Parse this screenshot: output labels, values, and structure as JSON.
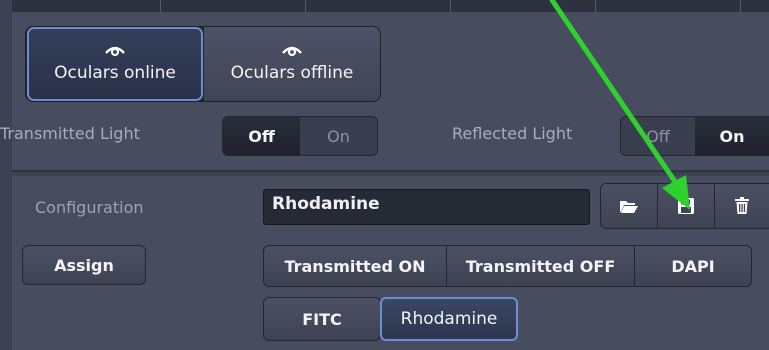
{
  "oculars": {
    "online_label": "Oculars online",
    "offline_label": "Oculars offline",
    "selected": "online"
  },
  "transmitted_light": {
    "label": "Transmitted Light",
    "off_label": "Off",
    "on_label": "On",
    "selected": "Off"
  },
  "reflected_light": {
    "label": "Reflected Light",
    "off_label": "Off",
    "on_label": "On",
    "selected": "On"
  },
  "configuration": {
    "label": "Configuration",
    "value": "Rhodamine",
    "icons": [
      "folder-open-icon",
      "save-icon",
      "trash-icon"
    ]
  },
  "assign_label": "Assign",
  "presets": [
    "Transmitted ON",
    "Transmitted OFF",
    "DAPI",
    "FITC",
    "Rhodamine"
  ],
  "active_preset": "Rhodamine",
  "colors": {
    "panel": "#474c5e",
    "active_border": "#6a8fd0",
    "annotation_arrow": "#33cc33"
  }
}
